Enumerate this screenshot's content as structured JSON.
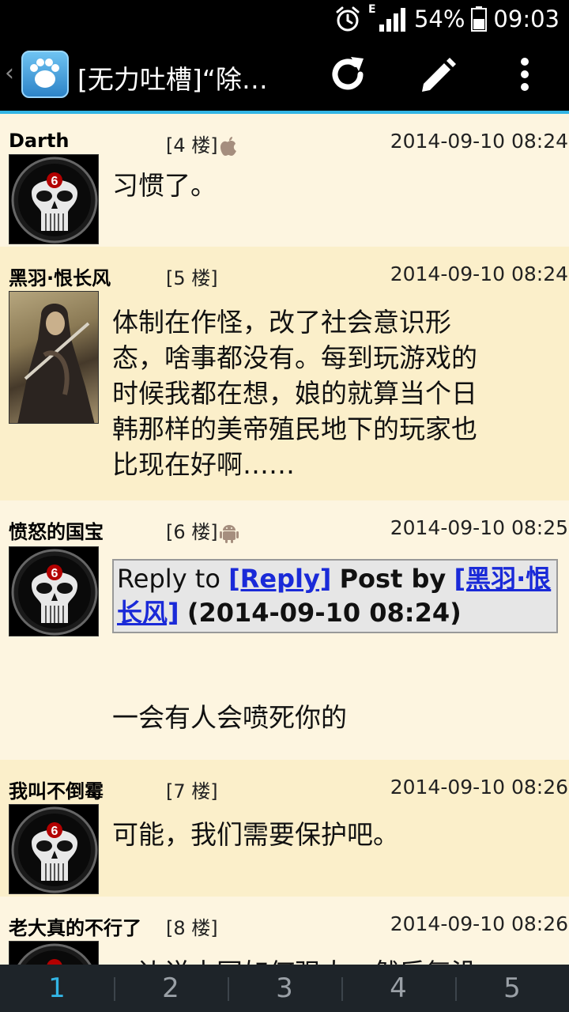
{
  "status_bar": {
    "network_type": "E",
    "battery": "54%",
    "time": "09:03"
  },
  "action_bar": {
    "title": "[无力吐槽]“除…"
  },
  "posts": [
    {
      "author": "Darth",
      "floor": "[4 楼]",
      "device": "apple-icon",
      "date": "2014-09-10 08:24",
      "body": "习惯了。"
    },
    {
      "author": "黑羽·恨长风",
      "floor": "[5 楼]",
      "device": "",
      "date": "2014-09-10 08:24",
      "body_lines": [
        "体制在作怪，改了社会意识形",
        "态，啥事都没有。每到玩游戏的",
        "时候我都在想，娘的就算当个日",
        "韩那样的美帝殖民地下的玩家也",
        "比现在好啊……"
      ]
    },
    {
      "author": "愤怒的国宝",
      "floor": "[6 楼]",
      "device": "android-icon",
      "date": "2014-09-10 08:25",
      "quote": {
        "reply_to": "Reply to",
        "reply_link": "[Reply]",
        "post_by": "Post by",
        "author_link_1": "[黑羽·恨",
        "author_link_2": "长风]",
        "date": "(2014-09-10 08:24)"
      },
      "body": "一会有人会喷死你的"
    },
    {
      "author": "我叫不倒霉",
      "floor": "[7 楼]",
      "device": "",
      "date": "2014-09-10 08:26",
      "body": "可能，我们需要保护吧。"
    },
    {
      "author": "老大真的不行了",
      "floor": "[8 楼]",
      "device": "",
      "date": "2014-09-10 08:26",
      "body": "一边说中国如何强大，然后复没"
    }
  ],
  "pager": {
    "pages": [
      "1",
      "2",
      "3",
      "4",
      "5"
    ],
    "current": "1"
  },
  "colors": {
    "accent": "#33b5e5",
    "post_bg_light": "#fdf5e0",
    "post_bg_dark": "#fbefca",
    "link": "#1a2ad8"
  }
}
